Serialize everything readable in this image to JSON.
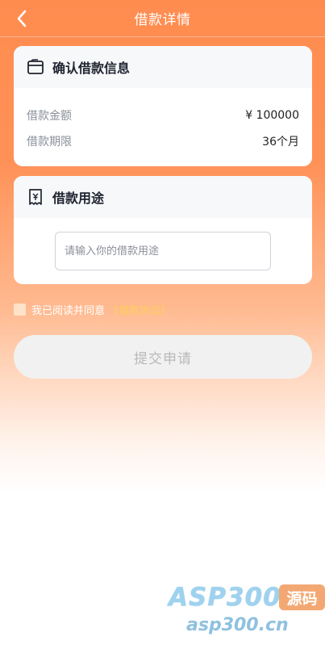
{
  "header": {
    "title": "借款详情"
  },
  "confirm_card": {
    "title": "确认借款信息",
    "rows": [
      {
        "label": "借款金额",
        "value": "¥ 100000"
      },
      {
        "label": "借款期限",
        "value": "36个月"
      }
    ]
  },
  "purpose_card": {
    "title": "借款用途",
    "input_placeholder": "请输入你的借款用途",
    "input_value": ""
  },
  "agreement": {
    "text": "我已阅读并同意",
    "link": "《借款协议》",
    "checked": false
  },
  "submit": {
    "label": "提交申请"
  },
  "watermark": {
    "logo": "ASP300",
    "badge": "源码",
    "url": "asp300.cn"
  },
  "colors": {
    "primary": "#ff8c4f",
    "link": "#ffd15c",
    "button_bg": "#f1f1f1"
  }
}
